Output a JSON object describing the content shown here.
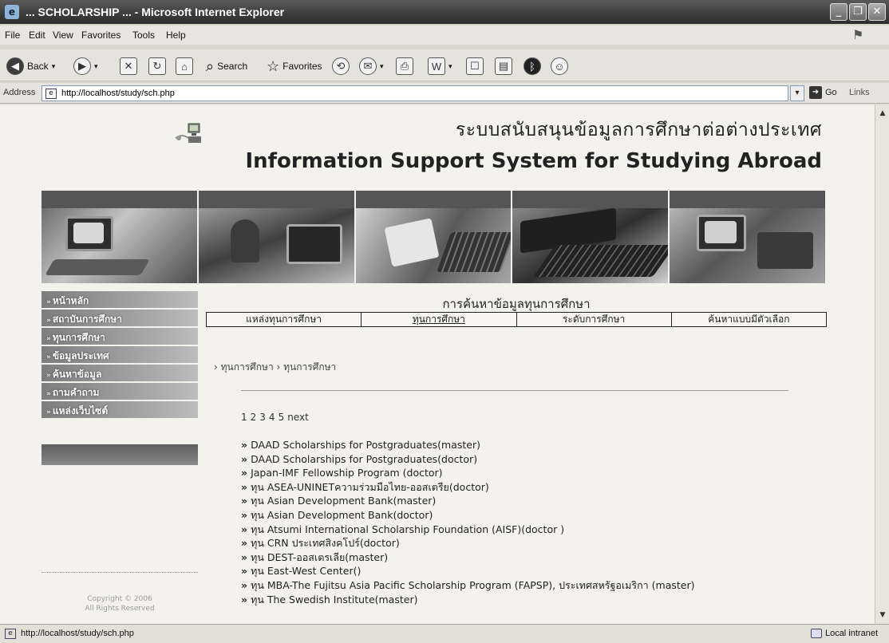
{
  "window": {
    "title": "... SCHOLARSHIP ... - Microsoft Internet Explorer"
  },
  "menu": [
    {
      "label": "File"
    },
    {
      "label": "Edit"
    },
    {
      "label": "View"
    },
    {
      "label": "Favorites"
    },
    {
      "label": "Tools"
    },
    {
      "label": "Help"
    }
  ],
  "toolbar": {
    "back_label": "Back",
    "search_label": "Search",
    "favorites_label": "Favorites"
  },
  "address": {
    "label": "Address",
    "url": "http://localhost/study/sch.php",
    "go_label": "Go",
    "links_label": "Links"
  },
  "header": {
    "title_thai": "ระบบสนับสนุนข้อมูลการศึกษาต่อต่างประเทศ",
    "title_en": "Information Support System for Studying Abroad"
  },
  "sidebar": {
    "items": [
      {
        "label": "หน้าหลัก"
      },
      {
        "label": "สถาบันการศึกษา"
      },
      {
        "label": "ทุนการศึกษา"
      },
      {
        "label": "ข้อมูลประเทศ"
      },
      {
        "label": "ค้นหาข้อมูล"
      },
      {
        "label": "ถามคำถาม"
      },
      {
        "label": "แหล่งเว็บไซต์"
      }
    ],
    "copyright_line1": "Copyright © 2006",
    "copyright_line2": "All Rights Reserved"
  },
  "search": {
    "heading": "การค้นหาข้อมูลทุนการศึกษา",
    "tabs": [
      {
        "label": "แหล่งทุนการศึกษา"
      },
      {
        "label": "ทุนการศึกษา"
      },
      {
        "label": "ระดับการศึกษา"
      },
      {
        "label": "ค้นหาแบบมีตัวเลือก"
      }
    ]
  },
  "breadcrumb": "› ทุนการศึกษา › ทุนการศึกษา",
  "pager": {
    "pages": [
      "1",
      "2",
      "3",
      "4",
      "5"
    ],
    "next_label": "next"
  },
  "scholarships": [
    "DAAD Scholarships for Postgraduates(master)",
    "DAAD Scholarships for Postgraduates(doctor)",
    "Japan-IMF Fellowship Program (doctor)",
    "ทุน ASEA-UNINETความร่วมมือไทย-ออสเตรีย(doctor)",
    "ทุน Asian Development Bank(master)",
    "ทุน Asian Development Bank(doctor)",
    "ทุน Atsumi International Scholarship Foundation (AISF)(doctor )",
    "ทุน CRN ประเทศสิงคโปร์(doctor)",
    "ทุน DEST-ออสเตรเลีย(master)",
    "ทุน East-West Center()",
    "ทุน MBA-The Fujitsu Asia Pacific Scholarship Program (FAPSP), ประเทศสหรัฐอเมริกา (master)",
    "ทุน The Swedish Institute(master)"
  ],
  "status": {
    "url": "http://localhost/study/sch.php",
    "zone": "Local intranet"
  }
}
